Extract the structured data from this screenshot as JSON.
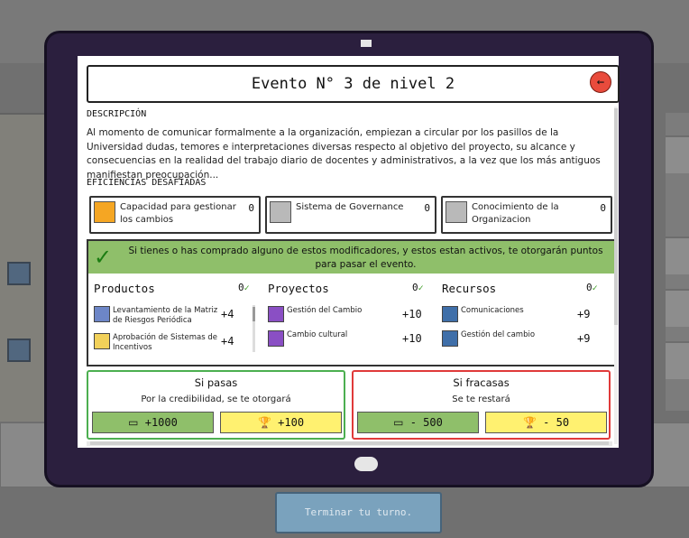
{
  "event": {
    "title": "Evento N° 3 de nivel 2",
    "back_icon": "←"
  },
  "description": {
    "heading": "DESCRIPCIÓN",
    "text": "Al momento de comunicar formalmente a la organización, empiezan a circular por los pasillos de la Universidad dudas, temores e interpretaciones diversas respecto al objetivo del proyecto, su alcance y consecuencias en la realidad del trabajo diario de docentes y administrativos, a la vez que los más antiguos manifiestan preocupación..."
  },
  "efficiencies": {
    "heading": "EFICIENCIAS DESAFIADAS",
    "items": [
      {
        "name": "Capacidad para gestionar los cambios",
        "value": "0",
        "icon": "lightbulb-gold-icon"
      },
      {
        "name": "Sistema de Governance",
        "value": "0",
        "icon": "lightbulb-gray-icon"
      },
      {
        "name": "Conocimiento de la Organizacion",
        "value": "0",
        "icon": "lightbulb-gray-icon"
      }
    ]
  },
  "modifiers": {
    "banner": "Si tienes o has comprado alguno de estos modificadores, y estos estan activos, te otorgarán puntos para pasar el evento.",
    "check_icon": "✓",
    "columns": [
      {
        "title": "Productos",
        "count": "0",
        "items": [
          {
            "name": "Levantamiento de la Matriz de Riesgos Periódica",
            "value": "+4",
            "icon": "warning-icon"
          },
          {
            "name": "Aprobación de Sistemas de Incentivos",
            "value": "+4",
            "icon": "trophy-icon"
          }
        ]
      },
      {
        "title": "Proyectos",
        "count": "0",
        "items": [
          {
            "name": "Gestión del Cambio",
            "value": "+10",
            "icon": "floppy-icon"
          },
          {
            "name": "Cambio cultural",
            "value": "+10",
            "icon": "floppy-icon"
          }
        ]
      },
      {
        "title": "Recursos",
        "count": "0",
        "items": [
          {
            "name": "Comunicaciones",
            "value": "+9",
            "icon": "building-icon"
          },
          {
            "name": "Gestión del cambio",
            "value": "+9",
            "icon": "building-icon"
          }
        ]
      }
    ],
    "tick": "✓"
  },
  "outcomes": {
    "pass": {
      "title": "Si pasas",
      "subtitle": "Por la credibilidad, se te otorgará",
      "money": "+1000",
      "trophy": "+100"
    },
    "fail": {
      "title": "Si fracasas",
      "subtitle": "Se te restará",
      "money": "- 500",
      "trophy": "- 50"
    },
    "money_icon": "▭",
    "trophy_icon": "🏆"
  },
  "footer": {
    "end_turn": "Terminar tu turno."
  },
  "colors": {
    "accent_red": "#e94b3c",
    "success_green": "#8fbf6a",
    "fail_red": "#e03a3a",
    "pass_green": "#4caf50",
    "trophy_yellow": "#fff170"
  }
}
